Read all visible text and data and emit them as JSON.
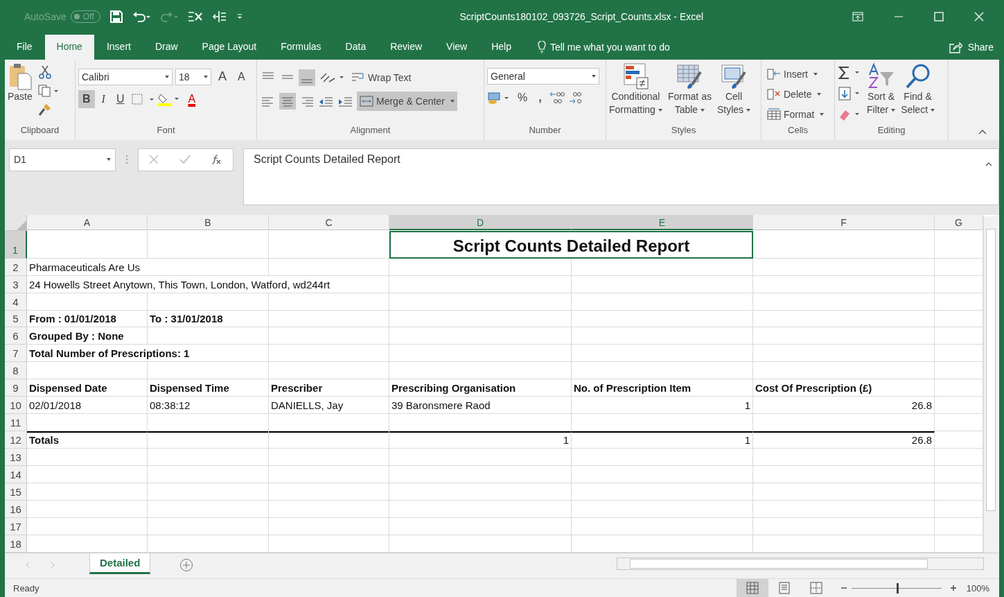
{
  "title_bar": {
    "autosave": "AutoSave",
    "autosave_toggle": "Off",
    "title": "ScriptCounts180102_093726_Script_Counts.xlsx  -  Excel"
  },
  "ribbon_tabs": [
    {
      "label": "File",
      "selected": false
    },
    {
      "label": "Home",
      "selected": true
    },
    {
      "label": "Insert",
      "selected": false
    },
    {
      "label": "Draw",
      "selected": false
    },
    {
      "label": "Page Layout",
      "selected": false
    },
    {
      "label": "Formulas",
      "selected": false
    },
    {
      "label": "Data",
      "selected": false
    },
    {
      "label": "Review",
      "selected": false
    },
    {
      "label": "View",
      "selected": false
    },
    {
      "label": "Help",
      "selected": false
    }
  ],
  "tell_me": "Tell me what you want to do",
  "share": "Share",
  "ribbon": {
    "clipboard": {
      "label": "Clipboard",
      "paste": "Paste"
    },
    "font": {
      "label": "Font",
      "name": "Calibri",
      "size": "18",
      "grow": "A",
      "shrink": "A",
      "bold": "B",
      "italic": "I",
      "underline": "U",
      "font_color_letter": "A"
    },
    "alignment": {
      "label": "Alignment",
      "wrap": "Wrap Text",
      "merge": "Merge & Center"
    },
    "number": {
      "label": "Number",
      "format": "General",
      "percent": "%",
      "comma": ","
    },
    "styles": {
      "label": "Styles",
      "conditional": [
        "Conditional",
        "Formatting"
      ],
      "table": [
        "Format as",
        "Table"
      ],
      "cell": [
        "Cell",
        "Styles"
      ]
    },
    "cells": {
      "label": "Cells",
      "insert": "Insert",
      "delete": "Delete",
      "format": "Format"
    },
    "editing": {
      "label": "Editing",
      "sort": [
        "Sort &",
        "Filter"
      ],
      "find": [
        "Find &",
        "Select"
      ]
    }
  },
  "name_box": "D1",
  "formula": "Script Counts Detailed Report",
  "columns": [
    {
      "letter": "A",
      "selected": false
    },
    {
      "letter": "B",
      "selected": false
    },
    {
      "letter": "C",
      "selected": false
    },
    {
      "letter": "D",
      "selected": true
    },
    {
      "letter": "E",
      "selected": true
    },
    {
      "letter": "F",
      "selected": false
    },
    {
      "letter": "G",
      "selected": false
    }
  ],
  "rows": [
    {
      "num": "1",
      "selected": true,
      "totals_line": false,
      "cells": [
        {},
        {},
        {},
        {
          "kind": "title",
          "text": "Script Counts Detailed Report",
          "bold": true,
          "selected": true
        }
      ]
    },
    {
      "num": "2",
      "selected": false,
      "totals_line": false,
      "cells": [
        {
          "kind": "text",
          "text": "Pharmaceuticals Are Us",
          "bold": false
        }
      ]
    },
    {
      "num": "3",
      "selected": false,
      "totals_line": false,
      "cells": [
        {
          "kind": "text",
          "text": "24 Howells Street Anytown, This Town, London, Watford, wd244rt",
          "bold": false
        }
      ]
    },
    {
      "num": "4",
      "selected": false,
      "totals_line": false
    },
    {
      "num": "5",
      "selected": false,
      "totals_line": false,
      "cells": [
        {
          "kind": "text",
          "text": "From : 01/01/2018",
          "bold": true
        },
        {
          "kind": "text",
          "text": "To : 31/01/2018",
          "bold": true
        }
      ]
    },
    {
      "num": "6",
      "selected": false,
      "totals_line": false,
      "cells": [
        {
          "kind": "text",
          "text": "Grouped By : None",
          "bold": true
        }
      ]
    },
    {
      "num": "7",
      "selected": false,
      "totals_line": false,
      "cells": [
        {
          "kind": "text",
          "text": "Total Number of Prescriptions: 1",
          "bold": true
        }
      ]
    },
    {
      "num": "8",
      "selected": false,
      "totals_line": false
    },
    {
      "num": "9",
      "selected": false,
      "totals_line": false,
      "cells": [
        {
          "kind": "text",
          "text": "Dispensed Date",
          "bold": true
        },
        {
          "kind": "text",
          "text": "Dispensed Time",
          "bold": true
        },
        {
          "kind": "text",
          "text": "Prescriber",
          "bold": true
        },
        {
          "kind": "text",
          "text": "Prescribing Organisation",
          "bold": true
        },
        {
          "kind": "text",
          "text": "No. of Prescription Item",
          "bold": true
        },
        {
          "kind": "text",
          "text": "Cost Of Prescription (£)",
          "bold": true
        }
      ]
    },
    {
      "num": "10",
      "selected": false,
      "totals_line": false,
      "cells": [
        {
          "kind": "text",
          "text": "02/01/2018",
          "bold": false
        },
        {
          "kind": "text",
          "text": "08:38:12",
          "bold": false
        },
        {
          "kind": "text",
          "text": "DANIELLS, Jay",
          "bold": false
        },
        {
          "kind": "text",
          "text": "39 Baronsmere Raod",
          "bold": false
        },
        {
          "kind": "number",
          "text": "1",
          "bold": false
        },
        {
          "kind": "number",
          "text": "26.8",
          "bold": false
        }
      ]
    },
    {
      "num": "11",
      "selected": false,
      "totals_line": false
    },
    {
      "num": "12",
      "selected": false,
      "totals_line": true,
      "cells": [
        {
          "kind": "text",
          "text": "Totals",
          "bold": true
        },
        {},
        {},
        {
          "kind": "number",
          "text": "1",
          "bold": false
        },
        {
          "kind": "number",
          "text": "1",
          "bold": false
        },
        {
          "kind": "number",
          "text": "26.8",
          "bold": false
        }
      ]
    },
    {
      "num": "13",
      "selected": false,
      "totals_line": false
    },
    {
      "num": "14",
      "selected": false,
      "totals_line": false
    },
    {
      "num": "15",
      "selected": false,
      "totals_line": false
    },
    {
      "num": "16",
      "selected": false,
      "totals_line": false
    },
    {
      "num": "17",
      "selected": false,
      "totals_line": false
    },
    {
      "num": "18",
      "selected": false,
      "totals_line": false
    }
  ],
  "sheet_tabs": [
    {
      "label": "Detailed",
      "selected": true
    }
  ],
  "status": {
    "text": "Ready",
    "zoom": "100%",
    "level": 0.5,
    "views": [
      {
        "kind": "normal",
        "selected": true
      },
      {
        "kind": "layout",
        "selected": false
      },
      {
        "kind": "break",
        "selected": false
      }
    ]
  }
}
